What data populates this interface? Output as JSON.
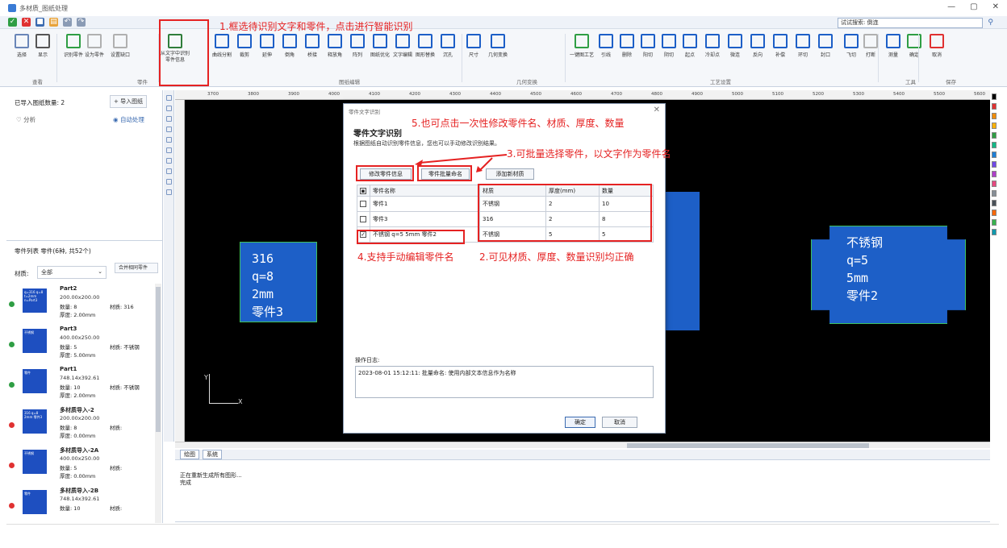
{
  "window": {
    "title": "多材质_图纸处理",
    "controls": [
      "—",
      "▢",
      "✕"
    ]
  },
  "search": {
    "value": "试试搜索: 倒连"
  },
  "ribbon": {
    "buttons": [
      {
        "label": "选择",
        "color": "#6a86b8"
      },
      {
        "label": "显示",
        "color": "#555555"
      },
      {
        "label": "识别零件",
        "color": "#2f9e44"
      },
      {
        "label": "设为零件",
        "color": "#b0b0b0"
      },
      {
        "label": "设置缺口",
        "color": "#b0b0b0"
      },
      {
        "label": "从文字中识别零件信息",
        "color": "#2f7d3a"
      },
      {
        "label": "曲线分割",
        "color": "#1d5fc7"
      },
      {
        "label": "裁剪",
        "color": "#1d5fc7"
      },
      {
        "label": "延伸",
        "color": "#1d5fc7"
      },
      {
        "label": "倒角",
        "color": "#1d5fc7"
      },
      {
        "label": "桥接",
        "color": "#1d5fc7"
      },
      {
        "label": "释放角",
        "color": "#1d5fc7"
      },
      {
        "label": "阵列",
        "color": "#1d5fc7"
      },
      {
        "label": "图纸优化",
        "color": "#1d5fc7"
      },
      {
        "label": "文字编辑",
        "color": "#1d5fc7"
      },
      {
        "label": "图形替换",
        "color": "#1d5fc7"
      },
      {
        "label": "沉孔",
        "color": "#1d5fc7"
      },
      {
        "label": "尺寸",
        "color": "#1d5fc7"
      },
      {
        "label": "几何变换",
        "color": "#1d5fc7"
      },
      {
        "label": "一键图工艺",
        "color": "#2f9e44"
      },
      {
        "label": "引线",
        "color": "#1d5fc7"
      },
      {
        "label": "删除",
        "color": "#1d5fc7"
      },
      {
        "label": "阳切",
        "color": "#1d5fc7"
      },
      {
        "label": "阴切",
        "color": "#1d5fc7"
      },
      {
        "label": "起点",
        "color": "#1d5fc7"
      },
      {
        "label": "冷却点",
        "color": "#1d5fc7"
      },
      {
        "label": "微连",
        "color": "#1d5fc7"
      },
      {
        "label": "反向",
        "color": "#1d5fc7"
      },
      {
        "label": "补偿",
        "color": "#1d5fc7"
      },
      {
        "label": "环切",
        "color": "#1d5fc7"
      },
      {
        "label": "封口",
        "color": "#1d5fc7"
      },
      {
        "label": "飞切",
        "color": "#1d5fc7"
      },
      {
        "label": "打断",
        "color": "#b0b0b0"
      },
      {
        "label": "测量",
        "color": "#1d5fc7"
      },
      {
        "label": "确定",
        "color": "#2f9e44"
      },
      {
        "label": "取消",
        "color": "#e03131"
      }
    ],
    "groups": [
      "查看",
      "零件",
      "图纸编辑",
      "几何变换",
      "工艺设置",
      "工具",
      "保存"
    ]
  },
  "left_panel": {
    "imported_count": "已导入图纸数量: 2",
    "import_button": "+ 导入图纸",
    "analysis": "分析",
    "auto_process": "自动处理",
    "part_list_header": "零件列表 零件(6种, 共52个)",
    "material_label": "材质:",
    "material_value": "全部",
    "merge_button": "合并相同零件",
    "parts": [
      {
        "name": "Part2",
        "size": "200.00x200.00",
        "qty": "数量: 8",
        "mat": "材质: 316",
        "thick": "厚度: 2.00mm",
        "dot": "#2f9e44",
        "thumb": "q=316 q=8 t=2mm n=Part3"
      },
      {
        "name": "Part3",
        "size": "400.00x250.00",
        "qty": "数量: 5",
        "mat": "材质: 不锈钢",
        "thick": "厚度: 5.00mm",
        "dot": "#2f9e44",
        "thumb": "不锈钢"
      },
      {
        "name": "Part1",
        "size": "748.14x392.61",
        "qty": "数量: 10",
        "mat": "材质: 不锈钢",
        "thick": "厚度: 2.00mm",
        "dot": "#2f9e44",
        "thumb": "零件"
      },
      {
        "name": "多材质导入-2",
        "size": "200.00x200.00",
        "qty": "数量: 8",
        "mat": "材质:",
        "thick": "厚度: 0.00mm",
        "dot": "#e03131",
        "thumb": "316 q=8 2mm 零件3"
      },
      {
        "name": "多材质导入-2A",
        "size": "400.00x250.00",
        "qty": "数量: 5",
        "mat": "材质:",
        "thick": "厚度: 0.00mm",
        "dot": "#e03131",
        "thumb": "不锈钢"
      },
      {
        "name": "多材质导入-2B",
        "size": "748.14x392.61",
        "qty": "数量: 10",
        "mat": "材质:",
        "thick": "",
        "dot": "#e03131",
        "thumb": "零件"
      }
    ]
  },
  "ruler": {
    "ticks": [
      "3700",
      "3800",
      "3900",
      "4000",
      "4100",
      "4200",
      "4300",
      "4400",
      "4500",
      "4600",
      "4700",
      "4800",
      "4900",
      "5000",
      "5100",
      "5200",
      "5300",
      "5400",
      "5500",
      "5600"
    ]
  },
  "canvas": {
    "shape_left_text": "316\nq=8\n2mm\n零件3",
    "shape_right_text": "不锈钢\nq=5\n5mm\n零件2",
    "axis_y": "Y",
    "axis_x": "X"
  },
  "dialog": {
    "title": "零件文字识别",
    "heading": "零件文字识别",
    "description": "根据图纸自动识别零件信息，您也可以手动修改识别结果。",
    "btn_modify": "修改零件信息",
    "btn_batch_name": "零件批量命名",
    "btn_add_material": "添加新材质",
    "columns": [
      "零件名称",
      "材质",
      "厚度(mm)",
      "数量"
    ],
    "rows": [
      {
        "checked": false,
        "name": "零件1",
        "mat": "不锈钢",
        "thick": "2",
        "qty": "10"
      },
      {
        "checked": false,
        "name": "零件3",
        "mat": "316",
        "thick": "2",
        "qty": "8"
      },
      {
        "checked": true,
        "name": "不锈钢 q=5 5mm 零件2",
        "mat": "不锈钢",
        "thick": "5",
        "qty": "5"
      }
    ],
    "log_label": "操作日志:",
    "log_text": "2023-08-01 15:12:11: 批量命名: 使用内部文本信息作为名称",
    "ok": "确定",
    "cancel": "取消"
  },
  "output": {
    "tabs": [
      "绘图",
      "系统"
    ],
    "lines": [
      "正在重新生成所有图形...",
      "完成"
    ]
  },
  "annotations": {
    "a1": "1.框选待识别文字和零件，点击进行智能识别",
    "a2": "2.可见材质、厚度、数量识别均正确",
    "a3": "3.可批量选择零件，以文字作为零件名",
    "a4": "4.支持手动编辑零件名",
    "a5": "5.也可点击一次性修改零件名、材质、厚度、数量"
  }
}
